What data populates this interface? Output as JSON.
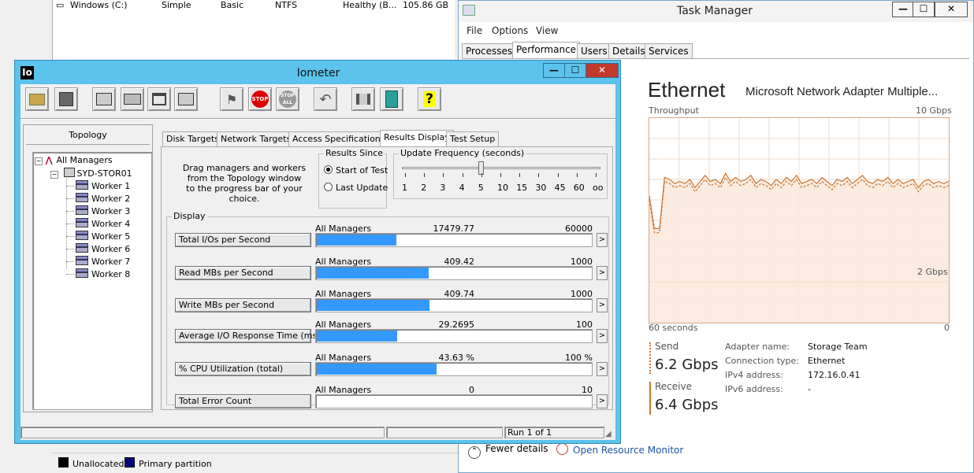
{
  "disk_mgmt": {
    "row": {
      "volume": "Windows (C:)",
      "layout": "Simple",
      "type": "Basic",
      "fs": "NTFS",
      "status": "Healthy (B...",
      "capacity": "105.86 GB"
    },
    "legend": {
      "unallocated": "Unallocated",
      "primary": "Primary partition",
      "unallocated_color": "#000000",
      "primary_color": "#000080"
    }
  },
  "task_manager": {
    "title": "Task Manager",
    "controls": {
      "minimize": "—",
      "maximize": "☐",
      "close": "✕"
    },
    "menu": [
      "File",
      "Options",
      "View"
    ],
    "tabs": [
      "Processes",
      "Performance",
      "Users",
      "Details",
      "Services"
    ],
    "active_tab": "Performance",
    "heading": "Ethernet",
    "adapter": "Microsoft Network Adapter Multiple...",
    "throughput_label": "Throughput",
    "max_label": "10 Gbps",
    "mid_label": "2 Gbps",
    "x_left": "60 seconds",
    "x_right": "0",
    "send_label": "Send",
    "send_value": "6.2 Gbps",
    "receive_label": "Receive",
    "receive_value": "6.4 Gbps",
    "details": [
      {
        "k": "Adapter name:",
        "v": "Storage Team"
      },
      {
        "k": "Connection type:",
        "v": "Ethernet"
      },
      {
        "k": "IPv4 address:",
        "v": "172.16.0.41"
      },
      {
        "k": "IPv6 address:",
        "v": "-"
      }
    ],
    "fewer_details": "Fewer details",
    "resource_monitor": "Open Resource Monitor",
    "accent_color": "#c87533",
    "link_color": "#1a55a8",
    "graph": {
      "y_max_gbps": 10,
      "receive": [
        6.2,
        4.6,
        4.6,
        7.1,
        7.0,
        6.8,
        6.9,
        6.8,
        7.0,
        6.6,
        6.9,
        7.2,
        6.9,
        7.0,
        6.8,
        7.3,
        6.9,
        7.1,
        6.9,
        7.0,
        7.2,
        6.8,
        7.0,
        6.9,
        6.7,
        7.0,
        6.8,
        7.1,
        6.9,
        7.2,
        6.8,
        6.9,
        7.0,
        6.8,
        7.1,
        6.9,
        6.7,
        7.0,
        6.9,
        7.1,
        6.8,
        7.0,
        7.2,
        6.9,
        6.8,
        7.0,
        6.9,
        7.1,
        6.8,
        7.0,
        6.8,
        6.9,
        7.0,
        6.6,
        6.9,
        7.0,
        6.8,
        6.9,
        6.8,
        6.9
      ],
      "send": [
        6.0,
        4.4,
        4.4,
        6.9,
        6.8,
        6.6,
        6.7,
        6.6,
        6.8,
        6.4,
        6.7,
        7.0,
        6.7,
        6.8,
        6.6,
        7.1,
        6.7,
        6.9,
        6.7,
        6.8,
        7.0,
        6.6,
        6.8,
        6.7,
        6.5,
        6.8,
        6.6,
        6.9,
        6.7,
        7.0,
        6.6,
        6.7,
        6.8,
        6.6,
        6.9,
        6.7,
        6.5,
        6.8,
        6.7,
        6.9,
        6.6,
        6.8,
        7.0,
        6.7,
        6.6,
        6.8,
        6.7,
        6.9,
        6.6,
        6.8,
        6.6,
        6.7,
        6.8,
        6.4,
        6.7,
        6.8,
        6.6,
        6.7,
        6.6,
        6.7
      ]
    }
  },
  "iometer": {
    "title": "Iometer",
    "logo": "Io",
    "controls": {
      "minimize": "—",
      "maximize": "☐",
      "close": "✕"
    },
    "toolbar": {
      "stop_label": "STOP",
      "stop_all_label": "STOP ALL",
      "help_label": "?"
    },
    "topology_label": "Topology",
    "tree": {
      "root": "All Managers",
      "manager": "SYD-STOR01",
      "workers": [
        "Worker 1",
        "Worker 2",
        "Worker 3",
        "Worker 4",
        "Worker 5",
        "Worker 6",
        "Worker 7",
        "Worker 8"
      ]
    },
    "tabs": [
      "Disk Targets",
      "Network Targets",
      "Access Specifications",
      "Results Display",
      "Test Setup"
    ],
    "active_tab": "Results Display",
    "drag_text": [
      "Drag managers and workers",
      "from the Topology window",
      "to the progress bar of your choice."
    ],
    "results_since": {
      "title": "Results Since",
      "start": "Start of Test",
      "last": "Last Update"
    },
    "update_freq": {
      "title": "Update Frequency (seconds)",
      "ticks": [
        "1",
        "2",
        "3",
        "4",
        "5",
        "10",
        "15",
        "30",
        "45",
        "60",
        "oo"
      ],
      "selected_index": 4
    },
    "display_label": "Display",
    "metrics": [
      {
        "label": "Total I/Os per Second",
        "source": "All Managers",
        "value": "17479.77",
        "max": "60000",
        "fraction": 0.2913
      },
      {
        "label": "Read MBs per Second",
        "source": "All Managers",
        "value": "409.42",
        "max": "1000",
        "fraction": 0.4094
      },
      {
        "label": "Write MBs per Second",
        "source": "All Managers",
        "value": "409.74",
        "max": "1000",
        "fraction": 0.4097
      },
      {
        "label": "Average I/O Response Time (ms)",
        "source": "All Managers",
        "value": "29.2695",
        "max": "100",
        "fraction": 0.2927
      },
      {
        "label": "% CPU Utilization (total)",
        "source": "All Managers",
        "value": "43.63 %",
        "max": "100 %",
        "fraction": 0.4363
      },
      {
        "label": "Total Error Count",
        "source": "All Managers",
        "value": "0",
        "max": "10",
        "fraction": 0
      }
    ],
    "arrow": ">",
    "status_run": "Run 1 of 1",
    "bar_color": "#3399ff"
  }
}
